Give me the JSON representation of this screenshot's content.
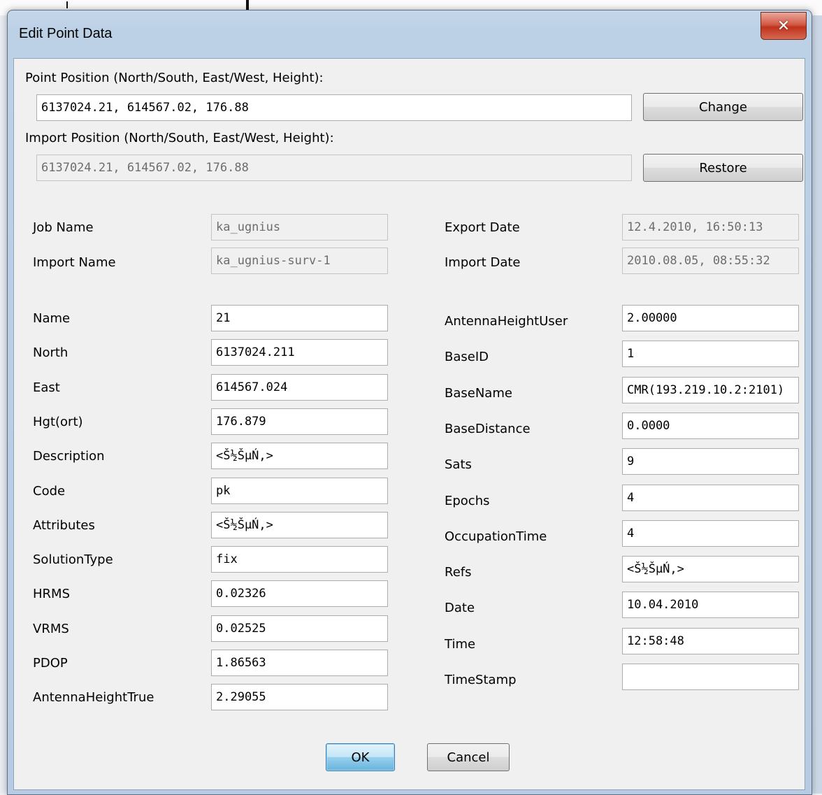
{
  "dialog": {
    "title": "Edit Point Data"
  },
  "point_position": {
    "label": "Point Position (North/South, East/West, Height):",
    "value": "6137024.21, 614567.02, 176.88",
    "button": "Change"
  },
  "import_position": {
    "label": "Import Position (North/South, East/West, Height):",
    "value": "6137024.21, 614567.02, 176.88",
    "button": "Restore"
  },
  "info": {
    "job_name": {
      "label": "Job Name",
      "value": "ka_ugnius"
    },
    "import_name": {
      "label": "Import Name",
      "value": "ka_ugnius-surv-1"
    },
    "export_date": {
      "label": "Export Date",
      "value": "12.4.2010, 16:50:13"
    },
    "import_date": {
      "label": "Import Date",
      "value": "2010.08.05, 08:55:32"
    }
  },
  "left_fields": [
    {
      "label": "Name",
      "value": "21"
    },
    {
      "label": "North",
      "value": "6137024.211"
    },
    {
      "label": "East",
      "value": "614567.024"
    },
    {
      "label": "Hgt(ort)",
      "value": "176.879"
    },
    {
      "label": "Description",
      "value": "<Š½ŠµŃ‚>"
    },
    {
      "label": "Code",
      "value": "pk"
    },
    {
      "label": "Attributes",
      "value": "<Š½ŠµŃ‚>"
    },
    {
      "label": "SolutionType",
      "value": "fix"
    },
    {
      "label": "HRMS",
      "value": "0.02326"
    },
    {
      "label": "VRMS",
      "value": "0.02525"
    },
    {
      "label": "PDOP",
      "value": "1.86563"
    },
    {
      "label": "AntennaHeightTrue",
      "value": "2.29055"
    }
  ],
  "right_fields": [
    {
      "label": "AntennaHeightUser",
      "value": "2.00000"
    },
    {
      "label": "BaseID",
      "value": "1"
    },
    {
      "label": "BaseName",
      "value": "CMR(193.219.10.2:2101)"
    },
    {
      "label": "BaseDistance",
      "value": "0.0000"
    },
    {
      "label": "Sats",
      "value": "9"
    },
    {
      "label": "Epochs",
      "value": "4"
    },
    {
      "label": "OccupationTime",
      "value": "4"
    },
    {
      "label": "Refs",
      "value": "<Š½ŠµŃ‚>"
    },
    {
      "label": "Date",
      "value": "10.04.2010"
    },
    {
      "label": "Time",
      "value": "12:58:48"
    },
    {
      "label": "TimeStamp",
      "value": ""
    }
  ],
  "buttons": {
    "ok": "OK",
    "cancel": "Cancel"
  },
  "colors": {
    "title_bar": "#bcd0e6",
    "close_button": "#c0321c",
    "dialog_bg": "#f0f0f0"
  }
}
